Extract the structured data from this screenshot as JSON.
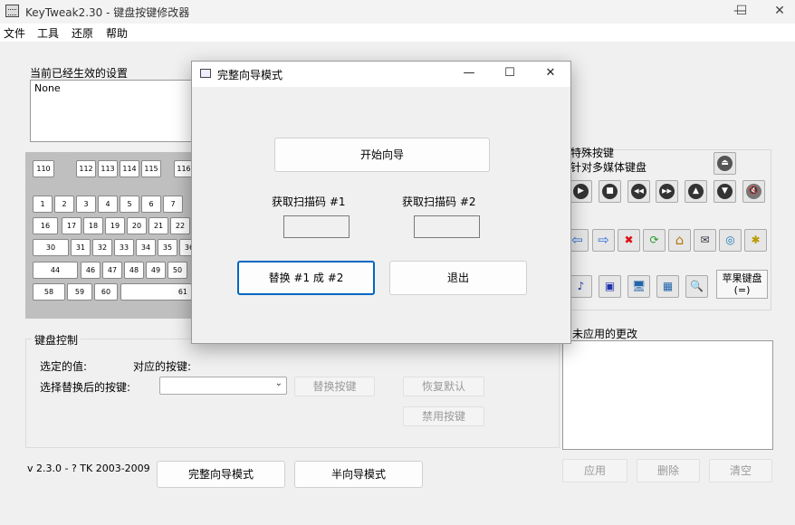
{
  "window": {
    "title": "KeyTweak2.30 -  键盘按键修改器",
    "minimize": "—",
    "maximize": "☐",
    "close": "✕"
  },
  "menu": [
    "文件",
    "工具",
    "还原",
    "帮助"
  ],
  "settings": {
    "label": "当前已经生效的设置",
    "value": "None"
  },
  "keyboard": {
    "rows": [
      [
        "110",
        "112",
        "113",
        "114",
        "115",
        "116"
      ],
      [
        "1",
        "2",
        "3",
        "4",
        "5",
        "6",
        "7"
      ],
      [
        "16",
        "17",
        "18",
        "19",
        "20",
        "21",
        "22"
      ],
      [
        "30",
        "31",
        "32",
        "33",
        "34",
        "35",
        "36"
      ],
      [
        "44",
        "46",
        "47",
        "48",
        "49",
        "50"
      ],
      [
        "58",
        "59",
        "60",
        "61"
      ]
    ]
  },
  "special": {
    "label_line1": "特殊按键",
    "label_line2": "针对多媒体键盘",
    "eject_icon": "⏏",
    "media_icons": [
      "▶",
      "■",
      "◀◀",
      "▶▶",
      "▲",
      "▼",
      "🔇"
    ],
    "nav_icons": [
      "⇦",
      "⇨",
      "✖",
      "⟳",
      "⌂",
      "✉",
      "◎",
      "✱"
    ],
    "app_icons": [
      "♪",
      "▣",
      "🖥",
      "▦",
      "🔍"
    ],
    "apple_line1": "苹果键盘",
    "apple_line2": "(=)"
  },
  "changes": {
    "label": "未应用的更改"
  },
  "control": {
    "title": "键盘控制",
    "selected_label": "选定的值:",
    "mapped_label": "对应的按键:",
    "choose_label": "选择替换后的按键:",
    "combo_arrow": "⌄",
    "replace_button": "替换按键",
    "restore_button": "恢复默认",
    "disable_button": "禁用按键"
  },
  "footer": {
    "version": "v 2.3.0 - ? TK 2003-2009",
    "full_wizard": "完整向导模式",
    "half_wizard": "半向导模式",
    "apply": "应用",
    "delete": "删除",
    "clear": "清空"
  },
  "dialog": {
    "title": "完整向导模式",
    "minimize": "—",
    "maximize": "☐",
    "close": "✕",
    "start_button": "开始向导",
    "scan1_label": "获取扫描码 #1",
    "scan2_label": "获取扫描码 #2",
    "replace_button": "替换 #1 成 #2",
    "exit_button": "退出"
  }
}
